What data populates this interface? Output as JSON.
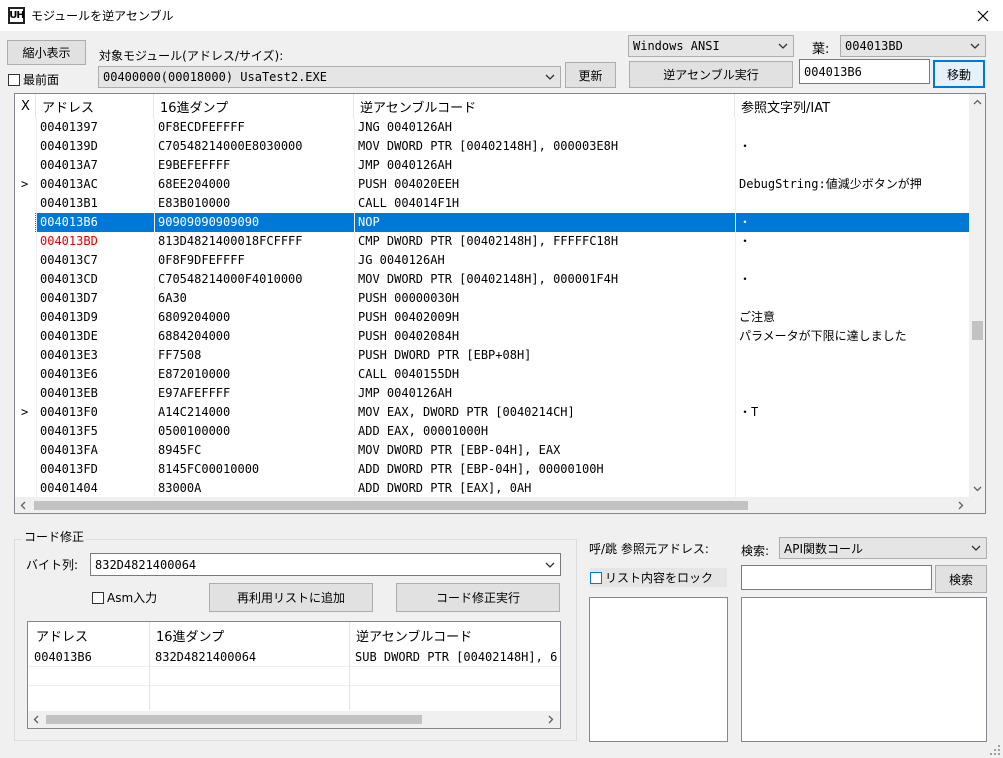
{
  "window": {
    "title": "モジュールを逆アセンブル",
    "logo_text": "UH"
  },
  "toolbar": {
    "shrink_button": "縮小表示",
    "topmost_label": "最前面",
    "module_label": "対象モジュール(アドレス/サイズ):",
    "module_value": "00400000(00018000) UsaTest2.EXE",
    "refresh_button": "更新",
    "encoding_value": "Windows ANSI",
    "leaf_label": "葉:",
    "leaf_value": "004013BD",
    "disasm_button": "逆アセンブル実行",
    "goto_address": "004013B6",
    "goto_button": "移動"
  },
  "table": {
    "columns": [
      "X",
      "アドレス",
      "16進ダンプ",
      "逆アセンブルコード",
      "参照文字列/IAT"
    ],
    "rows": [
      {
        "x": "",
        "addr": "00401397",
        "hex": "0F8ECDFEFFFF",
        "code": "JNG 0040126AH",
        "ref": ""
      },
      {
        "x": "",
        "addr": "0040139D",
        "hex": "C70548214000E8030000",
        "code": "MOV DWORD PTR [00402148H], 000003E8H",
        "ref": "・"
      },
      {
        "x": "",
        "addr": "004013A7",
        "hex": "E9BEFEFFFF",
        "code": "JMP 0040126AH",
        "ref": ""
      },
      {
        "x": ">",
        "addr": "004013AC",
        "hex": "68EE204000",
        "code": "PUSH 004020EEH",
        "ref": "DebugString:値減少ボタンが押"
      },
      {
        "x": "",
        "addr": "004013B1",
        "hex": "E83B010000",
        "code": "CALL 004014F1H",
        "ref": ""
      },
      {
        "x": "",
        "addr": "004013B6",
        "hex": "90909090909090",
        "code": "NOP",
        "ref": "・",
        "selected": true
      },
      {
        "x": "",
        "addr": "004013BD",
        "hex": "813D4821400018FCFFFF",
        "code": "CMP DWORD PTR [00402148H], FFFFFC18H",
        "ref": "・",
        "red": true
      },
      {
        "x": "",
        "addr": "004013C7",
        "hex": "0F8F9DFEFFFF",
        "code": "JG 0040126AH",
        "ref": ""
      },
      {
        "x": "",
        "addr": "004013CD",
        "hex": "C70548214000F4010000",
        "code": "MOV DWORD PTR [00402148H], 000001F4H",
        "ref": "・"
      },
      {
        "x": "",
        "addr": "004013D7",
        "hex": "6A30",
        "code": "PUSH 00000030H",
        "ref": ""
      },
      {
        "x": "",
        "addr": "004013D9",
        "hex": "6809204000",
        "code": "PUSH 00402009H",
        "ref": "ご注意"
      },
      {
        "x": "",
        "addr": "004013DE",
        "hex": "6884204000",
        "code": "PUSH 00402084H",
        "ref": "パラメータが下限に達しました"
      },
      {
        "x": "",
        "addr": "004013E3",
        "hex": "FF7508",
        "code": "PUSH DWORD PTR [EBP+08H]",
        "ref": ""
      },
      {
        "x": "",
        "addr": "004013E6",
        "hex": "E872010000",
        "code": "CALL 0040155DH",
        "ref": ""
      },
      {
        "x": "",
        "addr": "004013EB",
        "hex": "E97AFEFFFF",
        "code": "JMP 0040126AH",
        "ref": ""
      },
      {
        "x": ">",
        "addr": "004013F0",
        "hex": "A14C214000",
        "code": "MOV EAX, DWORD PTR [0040214CH]",
        "ref": "・T"
      },
      {
        "x": "",
        "addr": "004013F5",
        "hex": "0500100000",
        "code": "ADD EAX, 00001000H",
        "ref": ""
      },
      {
        "x": "",
        "addr": "004013FA",
        "hex": "8945FC",
        "code": "MOV DWORD PTR [EBP-04H], EAX",
        "ref": ""
      },
      {
        "x": "",
        "addr": "004013FD",
        "hex": "8145FC00010000",
        "code": "ADD DWORD PTR [EBP-04H], 00000100H",
        "ref": ""
      },
      {
        "x": "",
        "addr": "00401404",
        "hex": "83000A",
        "code": "ADD DWORD PTR [EAX], 0AH",
        "ref": ""
      }
    ]
  },
  "patch": {
    "group_label": "コード修正",
    "bytes_label": "バイト列:",
    "bytes_value": "832D4821400064",
    "asm_label": "Asm入力",
    "add_button": "再利用リストに追加",
    "exec_button": "コード修正実行",
    "columns": [
      "アドレス",
      "16進ダンプ",
      "逆アセンブルコード"
    ],
    "rows": [
      {
        "addr": "004013B6",
        "hex": "832D4821400064",
        "code": "SUB DWORD PTR [00402148H], 6"
      }
    ]
  },
  "xref": {
    "label": "呼/跳 参照元アドレス:",
    "lock_label": "リスト内容をロック"
  },
  "search": {
    "label": "検索:",
    "type_value": "API関数コール",
    "input_value": "",
    "button": "検索"
  },
  "colors": {
    "accent": "#0078d7",
    "highlight_text": "#e00000"
  }
}
